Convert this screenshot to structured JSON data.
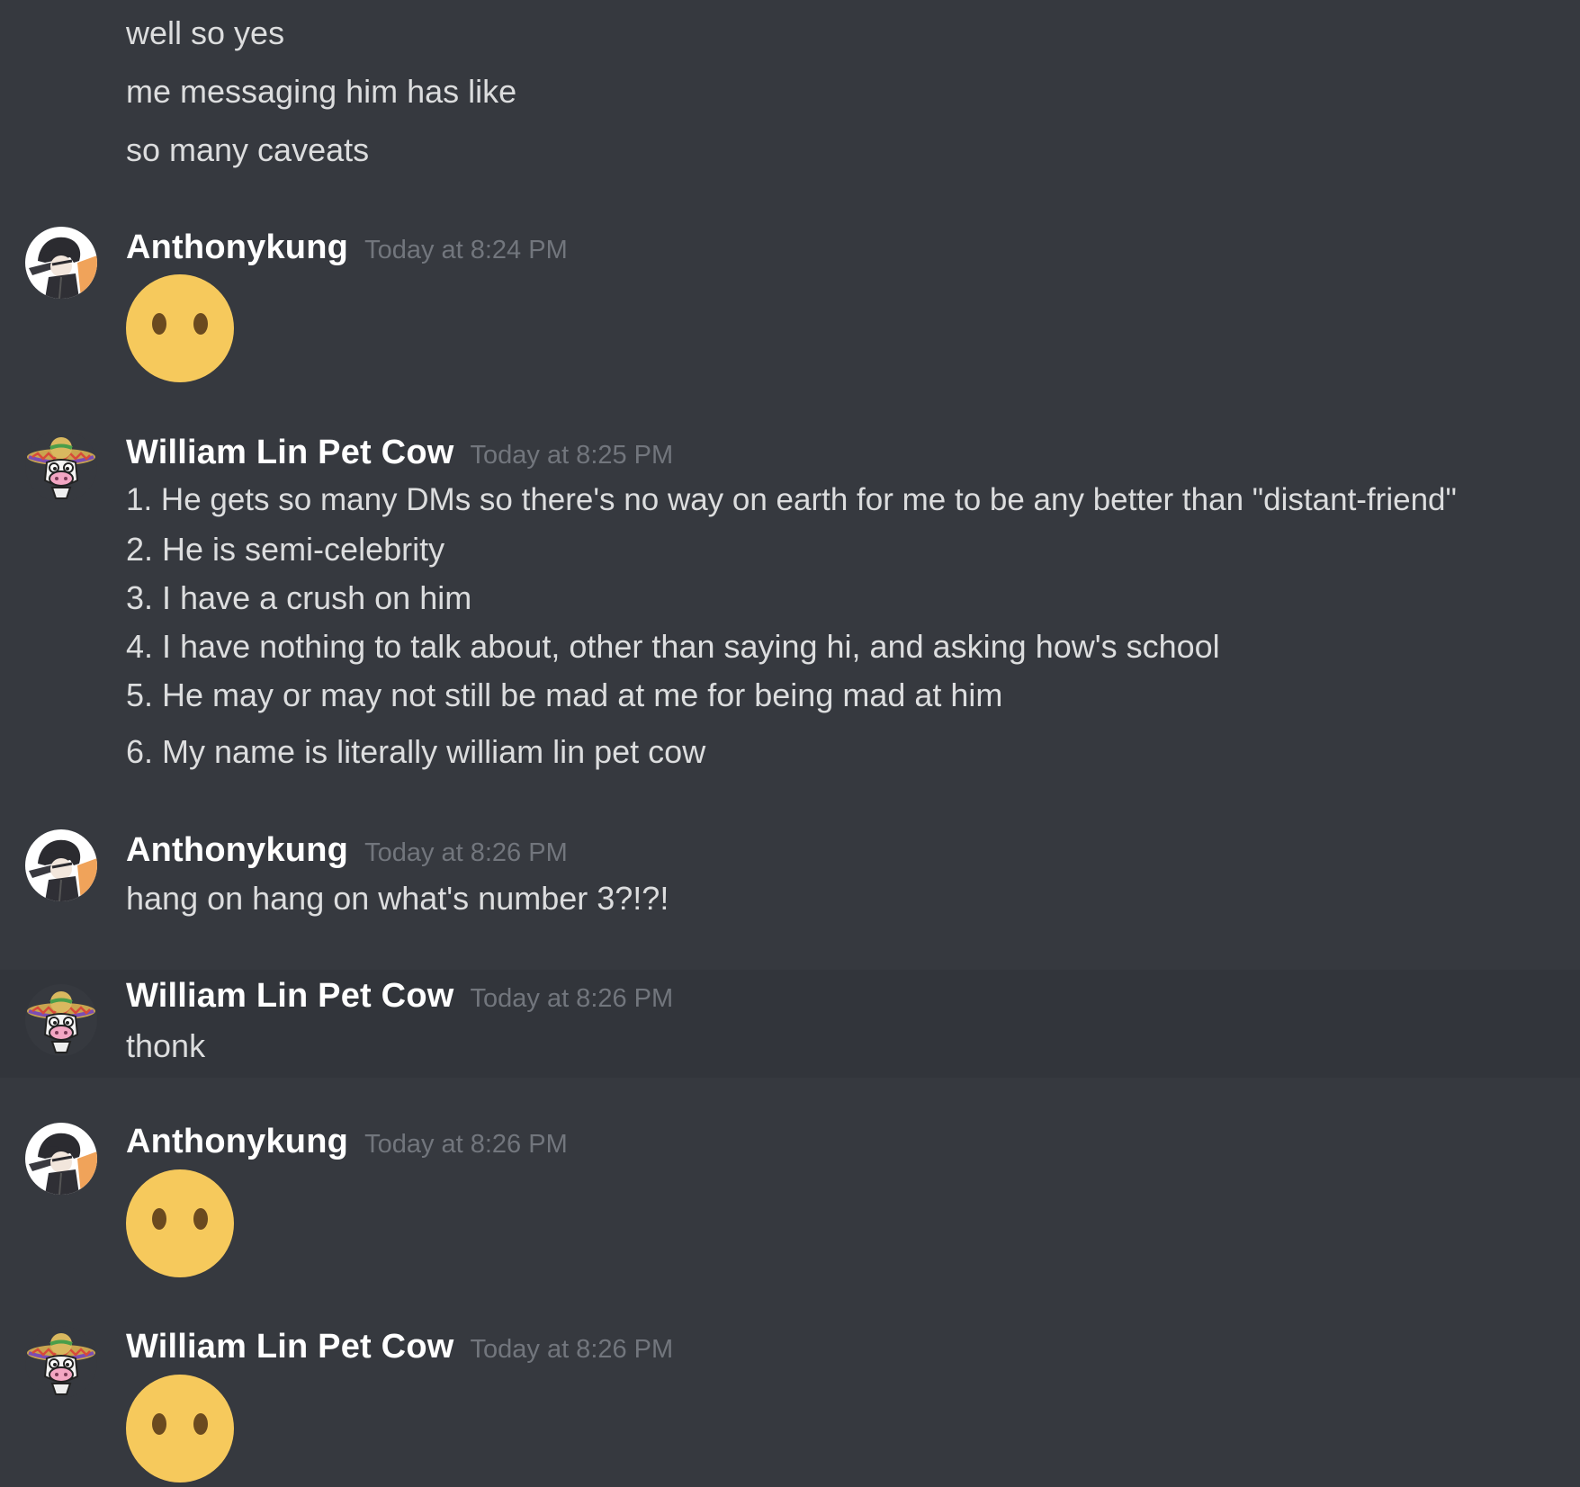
{
  "channel": {
    "leading_lines": [
      "well so yes",
      "me messaging him has like",
      "so many caveats"
    ],
    "messages": [
      {
        "author": "Anthonykung",
        "timestamp": "Today at 8:24 PM",
        "avatar_icon": "dabbing-person-avatar",
        "content": [],
        "emoji": "no-mouth-emoji"
      },
      {
        "author": "William Lin Pet Cow",
        "timestamp": "Today at 8:25 PM",
        "avatar_icon": "sombrero-cow-avatar",
        "content": [
          "1. He gets so many DMs so there's no way on earth for me to be any better than \"distant-friend\"",
          "2. He is semi-celebrity",
          "3. I have a crush on him",
          "4. I have nothing to talk about, other than saying hi, and asking how's school",
          "5. He may or may not still be mad at me for being mad at him",
          "6. My name is literally william lin pet cow"
        ]
      },
      {
        "author": "Anthonykung",
        "timestamp": "Today at 8:26 PM",
        "avatar_icon": "dabbing-person-avatar",
        "content": [
          "hang on hang on what's number 3?!?!"
        ]
      },
      {
        "author": "William Lin Pet Cow",
        "timestamp": "Today at 8:26 PM",
        "avatar_icon": "sombrero-cow-avatar",
        "content": [
          "thonk"
        ],
        "highlighted": true
      },
      {
        "author": "Anthonykung",
        "timestamp": "Today at 8:26 PM",
        "avatar_icon": "dabbing-person-avatar",
        "content": [],
        "emoji": "no-mouth-emoji"
      },
      {
        "author": "William Lin Pet Cow",
        "timestamp": "Today at 8:26 PM",
        "avatar_icon": "sombrero-cow-avatar",
        "content": [],
        "emoji": "no-mouth-emoji"
      }
    ]
  },
  "colors": {
    "background": "#36393f",
    "hover_background": "#32353b",
    "username": "#ffffff",
    "timestamp": "#72767d",
    "message_text": "#dcddde",
    "emoji_face": "#f6c95c",
    "emoji_eyes": "#6b4a1f"
  }
}
